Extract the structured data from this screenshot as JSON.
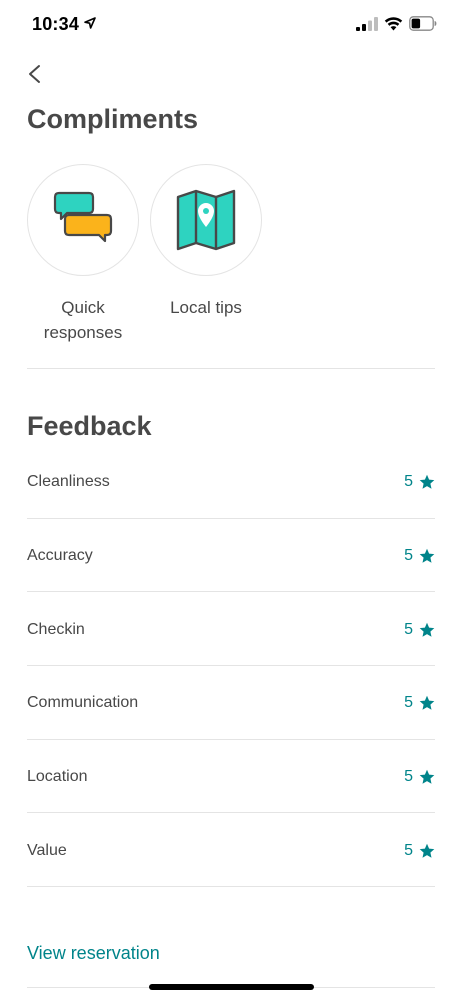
{
  "status_bar": {
    "time": "10:34"
  },
  "compliments": {
    "title": "Compliments",
    "items": [
      {
        "label": "Quick responses",
        "icon": "chat-bubbles-icon"
      },
      {
        "label": "Local tips",
        "icon": "map-pin-icon"
      }
    ]
  },
  "feedback": {
    "title": "Feedback",
    "rows": [
      {
        "label": "Cleanliness",
        "value": "5"
      },
      {
        "label": "Accuracy",
        "value": "5"
      },
      {
        "label": "Checkin",
        "value": "5"
      },
      {
        "label": "Communication",
        "value": "5"
      },
      {
        "label": "Location",
        "value": "5"
      },
      {
        "label": "Value",
        "value": "5"
      }
    ]
  },
  "link": {
    "view_reservation": "View reservation"
  },
  "colors": {
    "accent": "#00848a",
    "text": "#484848",
    "teal_icon": "#2ed3c0",
    "yellow_icon": "#fbb31b",
    "divider": "#e4e4e4"
  }
}
